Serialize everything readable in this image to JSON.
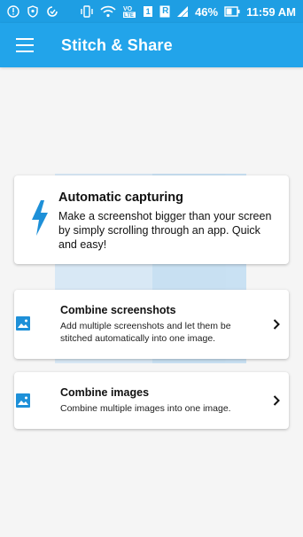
{
  "status_bar": {
    "icons": [
      "alert-icon",
      "shield-icon",
      "data-saver-icon",
      "vibrate-icon",
      "wifi-icon",
      "volte-icon",
      "sim-icon",
      "roaming-icon",
      "signal-icon",
      "battery-icon"
    ],
    "sim_badge": "1",
    "roaming_badge": "R",
    "battery_percent": "46%",
    "time": "11:59 AM"
  },
  "app_bar": {
    "title": "Stitch & Share",
    "menu_icon": "hamburger-menu-icon",
    "color": "#22a4ea"
  },
  "features": {
    "automatic": {
      "icon": "lightning-bolt-icon",
      "title": "Automatic capturing",
      "description": "Make a screenshot bigger than your screen by simply scrolling through an app. Quick and easy!"
    },
    "combine_screenshots": {
      "icon": "image-icon",
      "title": "Combine screenshots",
      "description": "Add multiple screenshots and let them be stitched automatically into one image."
    },
    "combine_images": {
      "icon": "image-icon",
      "title": "Combine images",
      "description": "Combine multiple images into one image."
    }
  },
  "colors": {
    "accent": "#1e90d8",
    "status_bar": "#1e9ee3",
    "background": "#f5f5f5"
  }
}
